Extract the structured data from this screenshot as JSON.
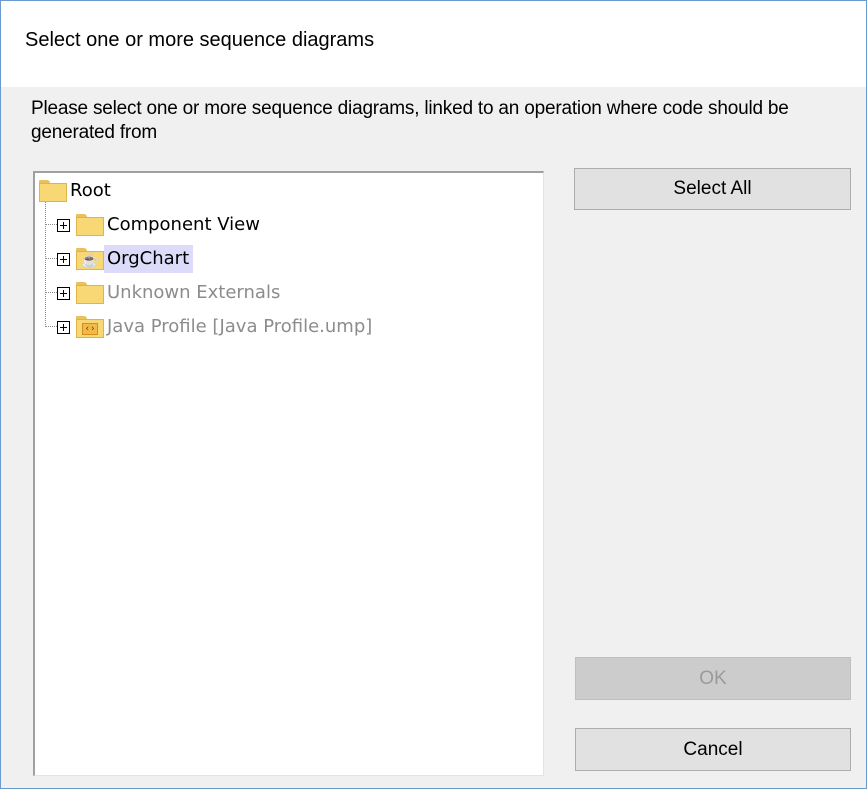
{
  "dialog": {
    "title": "Select one or more sequence diagrams",
    "instructions": "Please select one or more sequence diagrams, linked to an operation where code should be generated from"
  },
  "tree": {
    "root": {
      "label": "Root",
      "icon": "folder-icon"
    },
    "children": [
      {
        "label": "Component View",
        "icon": "folder-icon",
        "state": "normal"
      },
      {
        "label": "OrgChart",
        "icon": "java-package-icon",
        "state": "selected"
      },
      {
        "label": "Unknown Externals",
        "icon": "folder-icon",
        "state": "dim"
      },
      {
        "label": "Java Profile [Java Profile.ump]",
        "icon": "profile-package-icon",
        "state": "dim"
      }
    ]
  },
  "buttons": {
    "select_all": "Select All",
    "ok": "OK",
    "cancel": "Cancel"
  },
  "colors": {
    "window_border": "#6b9ad1",
    "dialog_bg": "#f0f0f0",
    "selection_bg": "#dcdcfa",
    "dim_text": "#8c8c8c",
    "folder_yellow": "#f8d775"
  }
}
